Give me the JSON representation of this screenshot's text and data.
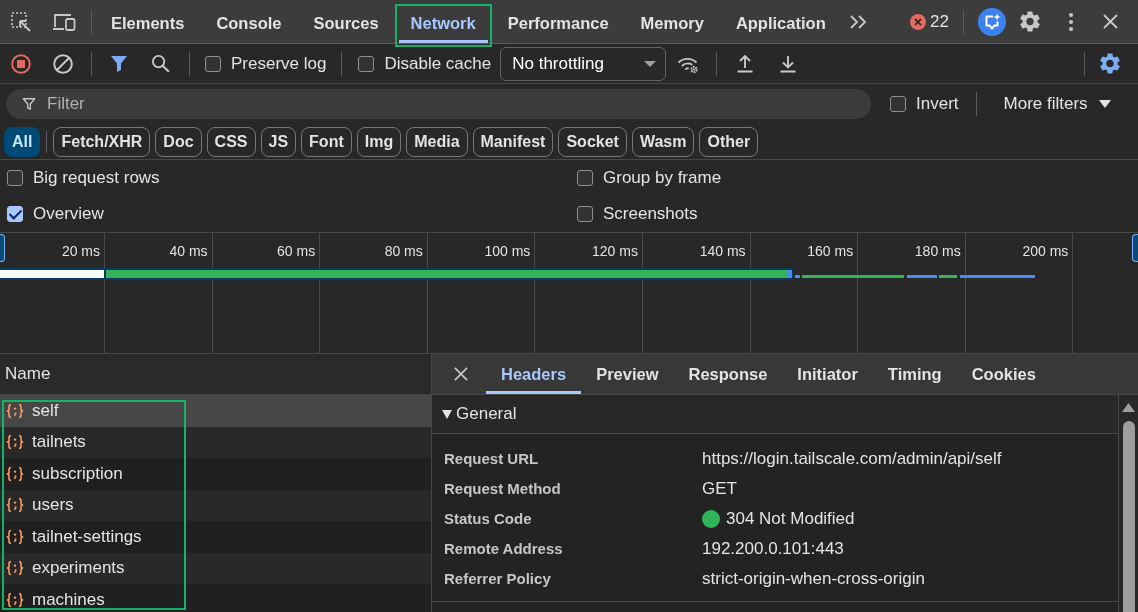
{
  "main_tabs": [
    {
      "label": "Elements",
      "selected": false,
      "highlighted": false
    },
    {
      "label": "Console",
      "selected": false,
      "highlighted": false
    },
    {
      "label": "Sources",
      "selected": false,
      "highlighted": false
    },
    {
      "label": "Network",
      "selected": true,
      "highlighted": true
    },
    {
      "label": "Performance",
      "selected": false,
      "highlighted": false
    },
    {
      "label": "Memory",
      "selected": false,
      "highlighted": false
    },
    {
      "label": "Application",
      "selected": false,
      "highlighted": false
    }
  ],
  "error_count": "22",
  "network_toolbar": {
    "recording": true,
    "checkboxes": [
      {
        "label": "Preserve log",
        "checked": false
      },
      {
        "label": "Disable cache",
        "checked": false
      }
    ],
    "throttling": "No throttling"
  },
  "filter_bar": {
    "placeholder": "Filter",
    "invert": {
      "label": "Invert",
      "checked": false
    },
    "more_filters": "More filters"
  },
  "type_filters": [
    {
      "label": "All",
      "selected": true
    },
    {
      "label": "Fetch/XHR",
      "selected": false
    },
    {
      "label": "Doc",
      "selected": false
    },
    {
      "label": "CSS",
      "selected": false
    },
    {
      "label": "JS",
      "selected": false
    },
    {
      "label": "Font",
      "selected": false
    },
    {
      "label": "Img",
      "selected": false
    },
    {
      "label": "Media",
      "selected": false
    },
    {
      "label": "Manifest",
      "selected": false
    },
    {
      "label": "Socket",
      "selected": false
    },
    {
      "label": "Wasm",
      "selected": false
    },
    {
      "label": "Other",
      "selected": false
    }
  ],
  "settings": [
    {
      "label": "Big request rows",
      "checked": false
    },
    {
      "label": "Group by frame",
      "checked": false
    },
    {
      "label": "Overview",
      "checked": true
    },
    {
      "label": "Screenshots",
      "checked": false
    }
  ],
  "overview": {
    "ticks": [
      "20 ms",
      "40 ms",
      "60 ms",
      "80 ms",
      "100 ms",
      "120 ms",
      "140 ms",
      "160 ms",
      "180 ms",
      "200 ms"
    ]
  },
  "requests": {
    "column": "Name",
    "highlighted": true,
    "rows": [
      {
        "name": "self",
        "selected": true
      },
      {
        "name": "tailnets",
        "selected": false
      },
      {
        "name": "subscription",
        "selected": false
      },
      {
        "name": "users",
        "selected": false
      },
      {
        "name": "tailnet-settings",
        "selected": false
      },
      {
        "name": "experiments",
        "selected": false
      },
      {
        "name": "machines",
        "selected": false
      }
    ]
  },
  "details": {
    "tabs": [
      {
        "label": "Headers",
        "selected": true
      },
      {
        "label": "Preview",
        "selected": false
      },
      {
        "label": "Response",
        "selected": false
      },
      {
        "label": "Initiator",
        "selected": false
      },
      {
        "label": "Timing",
        "selected": false
      },
      {
        "label": "Cookies",
        "selected": false
      }
    ],
    "section": {
      "title": "General",
      "expanded": true,
      "fields": [
        {
          "label": "Request URL",
          "value": "https://login.tailscale.com/admin/api/self"
        },
        {
          "label": "Request Method",
          "value": "GET"
        },
        {
          "label": "Status Code",
          "value": "304 Not Modified",
          "color": "#2fb45a"
        },
        {
          "label": "Remote Address",
          "value": "192.200.0.101:443"
        },
        {
          "label": "Referrer Policy",
          "value": "strict-origin-when-cross-origin"
        }
      ]
    }
  }
}
